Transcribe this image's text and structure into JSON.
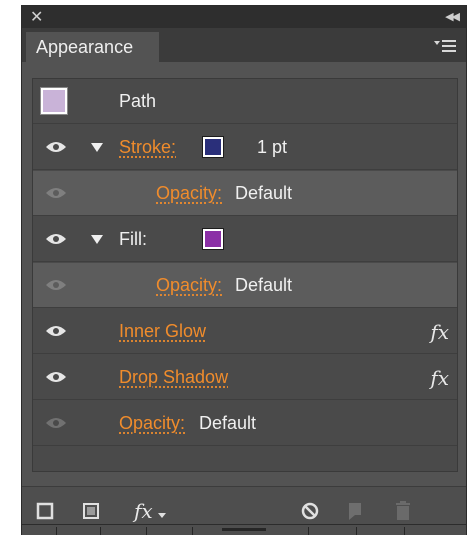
{
  "panel": {
    "tab_label": "Appearance",
    "close_icon": "close-icon",
    "collapse_icon": "collapse-double-arrow-icon",
    "menu_icon": "panel-menu-icon"
  },
  "rows": {
    "path": {
      "label": "Path",
      "thumbnail_color": "#c9b3d8"
    },
    "stroke": {
      "label": "Stroke:",
      "value": "1 pt",
      "swatch_color": "#2a2f7a"
    },
    "stroke_opacity": {
      "label": "Opacity:",
      "value": "Default"
    },
    "fill": {
      "label": "Fill:",
      "swatch_color": "#8b2fa6"
    },
    "fill_opacity": {
      "label": "Opacity:",
      "value": "Default"
    },
    "inner_glow": {
      "label": "Inner Glow",
      "fx": "fx"
    },
    "drop_shadow": {
      "label": "Drop Shadow",
      "fx": "fx"
    },
    "opacity": {
      "label": "Opacity:",
      "value": "Default"
    }
  },
  "bottom_toolbar": {
    "fx_label": "fx",
    "icons": [
      "add-new-stroke-icon",
      "add-new-fill-icon",
      "add-new-effect-icon",
      "clear-appearance-icon",
      "duplicate-item-icon",
      "delete-item-icon"
    ]
  },
  "colors": {
    "accent": "#f08c2c",
    "panel_bg": "#535353",
    "titlebar_bg": "#2e2e2e"
  }
}
